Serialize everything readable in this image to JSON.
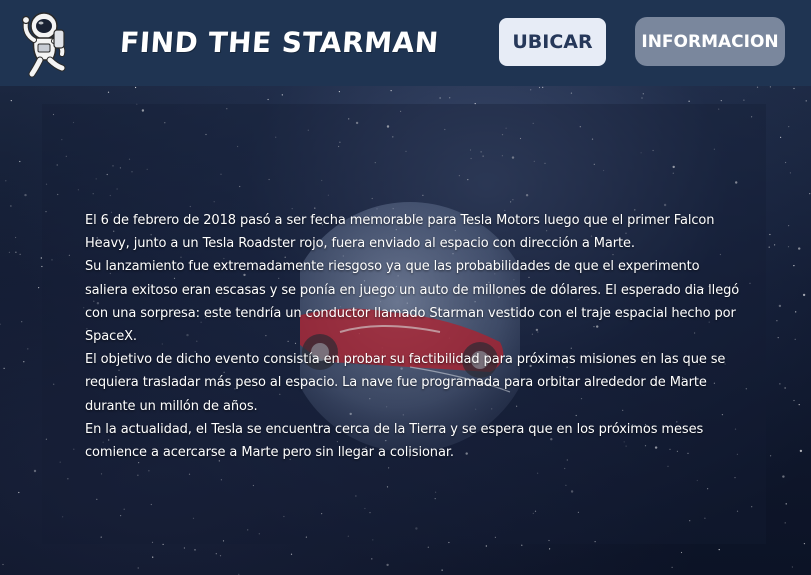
{
  "header": {
    "title": "FIND THE STARMAN",
    "logo_icon": "astronaut-icon",
    "nav": {
      "locate_label": "UBICAR",
      "info_label": "INFORMACION"
    }
  },
  "main": {
    "paragraphs": [
      "El 6 de febrero de 2018 pasó a ser fecha memorable para Tesla Motors luego que el primer Falcon Heavy, junto a un Tesla Roadster rojo, fuera enviado al espacio con dirección a Marte.",
      "Su lanzamiento fue extremadamente riesgoso ya que las probabilidades de que el experimento saliera exitoso eran escasas y se ponía en juego un auto de millones de dólares. El esperado dia llegó con una sorpresa: este tendría un conductor llamado Starman vestido con el traje espacial hecho por SpaceX.",
      "El objetivo de dicho evento consistía en probar su factibilidad para próximas misiones en las que se requiera trasladar más peso al espacio. La nave fue programada para orbitar alrededor de Marte durante un millón de años.",
      "En la actualidad, el Tesla se encuentra cerca de la Tierra y se espera que en los próximos meses comience a acercarse a Marte pero sin llegar a colisionar."
    ]
  },
  "colors": {
    "header_bg": "#1f3452",
    "locate_button_bg": "#e7ecf6",
    "info_button_bg": "#7a879d",
    "text": "#ffffff"
  }
}
